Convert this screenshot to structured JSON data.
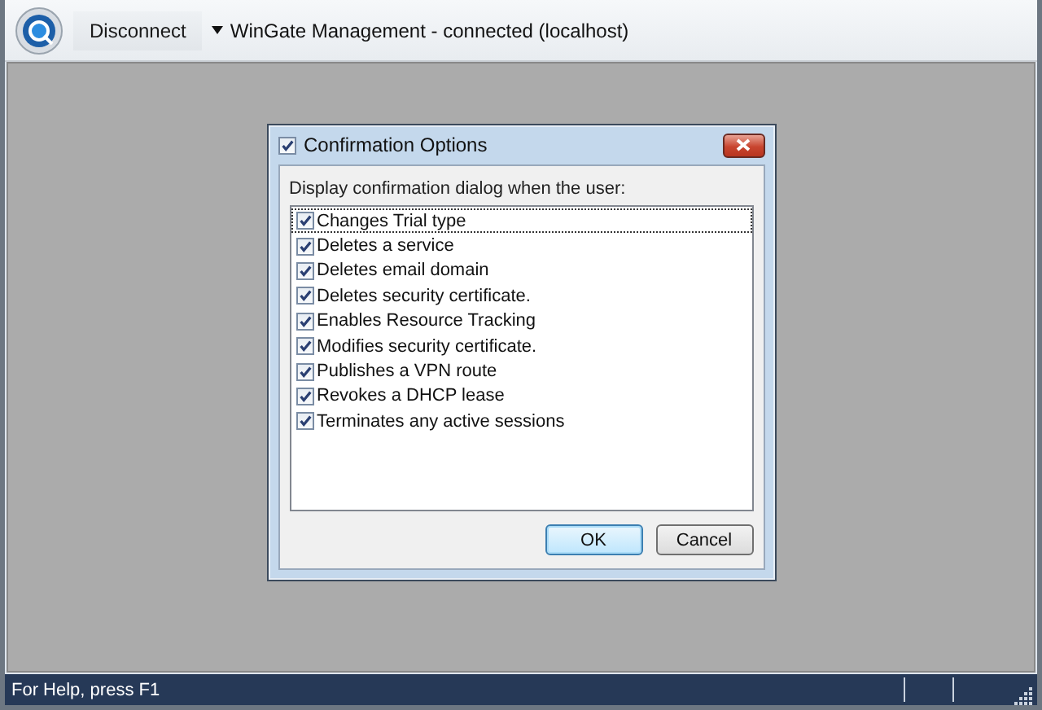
{
  "toolbar": {
    "disconnect_button": "Disconnect",
    "connection_menu": "WinGate Management - connected (localhost)"
  },
  "dialog": {
    "title": "Confirmation Options",
    "title_checked": true,
    "prompt": "Display confirmation dialog when the user:",
    "options": [
      {
        "label": "Changes Trial type",
        "checked": true,
        "focused": true
      },
      {
        "label": "Deletes a service",
        "checked": true,
        "focused": false
      },
      {
        "label": "Deletes email domain",
        "checked": true,
        "focused": false
      },
      {
        "label": "Deletes security certificate.",
        "checked": true,
        "focused": false
      },
      {
        "label": "Enables Resource Tracking",
        "checked": true,
        "focused": false
      },
      {
        "label": "Modifies security certificate.",
        "checked": true,
        "focused": false
      },
      {
        "label": "Publishes a VPN route",
        "checked": true,
        "focused": false
      },
      {
        "label": "Revokes a DHCP lease",
        "checked": true,
        "focused": false
      },
      {
        "label": "Terminates any active sessions",
        "checked": true,
        "focused": false
      }
    ],
    "buttons": [
      {
        "label": "OK",
        "default": true
      },
      {
        "label": "Cancel",
        "default": false
      }
    ]
  },
  "status_bar": {
    "text": "For Help, press F1"
  }
}
